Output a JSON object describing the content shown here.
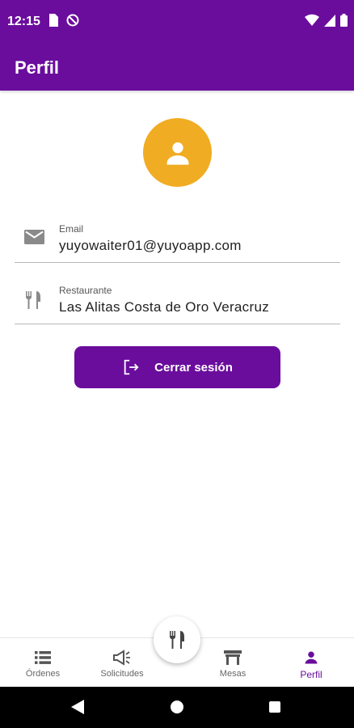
{
  "status_bar": {
    "time": "12:15",
    "left_icons": [
      "sim-card-icon",
      "do-not-disturb-icon"
    ],
    "right_icons": [
      "wifi-icon",
      "signal-icon",
      "battery-icon"
    ]
  },
  "app_bar": {
    "title": "Perfil"
  },
  "profile": {
    "avatar_icon": "person-icon",
    "avatar_color": "#f0ac22",
    "email": {
      "icon": "mail-icon",
      "label": "Email",
      "value": "yuyowaiter01@yuyoapp.com"
    },
    "restaurant": {
      "icon": "restaurant-icon",
      "label": "Restaurante",
      "value": "Las Alitas Costa de Oro Veracruz"
    },
    "logout": {
      "icon": "logout-icon",
      "label": "Cerrar sesión"
    }
  },
  "bottom_nav": {
    "items": [
      {
        "label": "Órdenes",
        "icon": "list-icon",
        "active": false
      },
      {
        "label": "Solicitudes",
        "icon": "megaphone-icon",
        "active": false
      },
      {
        "label": "Mesas",
        "icon": "table-icon",
        "active": false
      },
      {
        "label": "Perfil",
        "icon": "person-icon",
        "active": true
      }
    ],
    "fab_icon": "restaurant-icon"
  },
  "colors": {
    "primary": "#6a0d9d",
    "accent": "#f0ac22"
  }
}
